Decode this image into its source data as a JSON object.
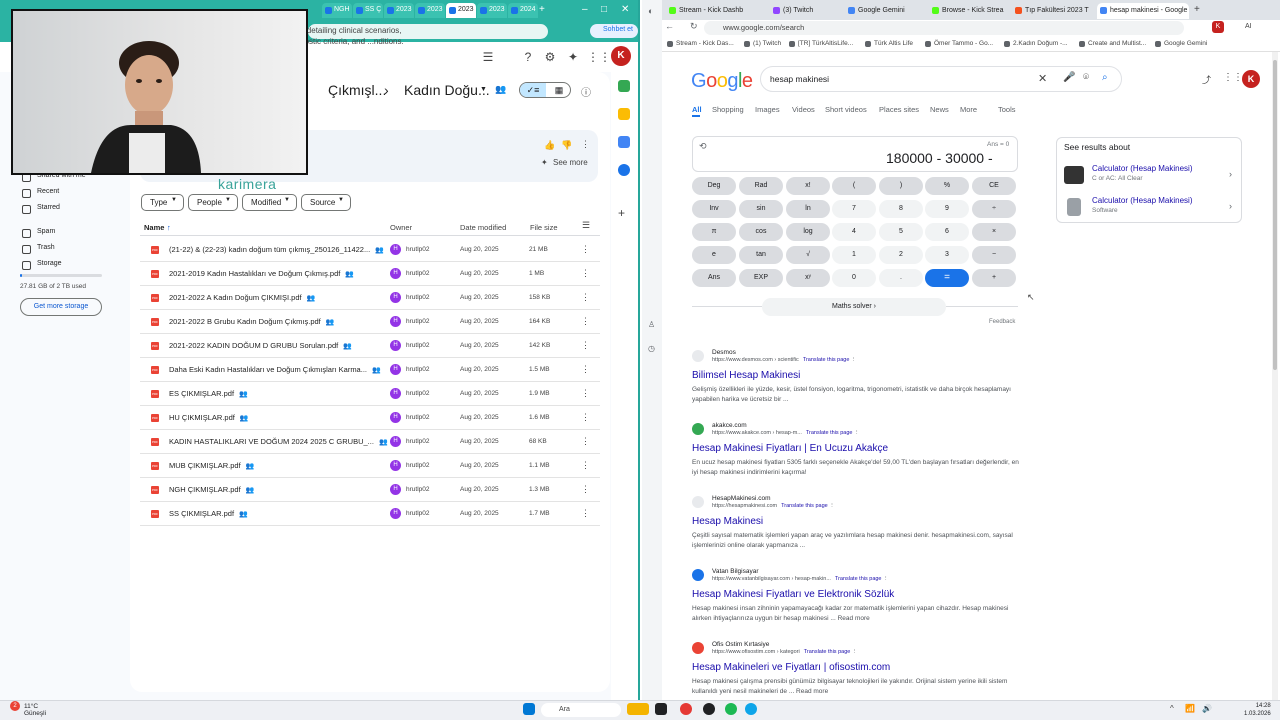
{
  "left_window": {
    "tabs": [
      "",
      "",
      "",
      "",
      "NGH",
      "SS Ç",
      "2023",
      "2023",
      "2023",
      "2023",
      "2023",
      "2024",
      "2024"
    ],
    "sohbet_label": "Sohbet et",
    "avatar_letter": "K",
    "breadcrumb": [
      "Çıkmışl...",
      "Kadın Doğu..."
    ],
    "summary_text": "...ons detailing clinical scenarios, diagnostic criteria, and ...nditions.",
    "see_more": "See more",
    "karimera": "karimera",
    "filters": [
      "Type",
      "People",
      "Modified",
      "Source"
    ],
    "columns": {
      "name": "Name",
      "owner": "Owner",
      "modified": "Date modified",
      "size": "File size"
    },
    "nav": [
      "Shared with me",
      "Recent",
      "Starred",
      "Spam",
      "Trash",
      "Storage"
    ],
    "storage": {
      "used_text": "27.81 GB of 2 TB used",
      "fraction": 0.014,
      "button": "Get more storage"
    },
    "files": [
      {
        "name": "(21-22) & (22-23) kadın doğum tüm çıkmış_250126_11422...",
        "shared": true,
        "owner": "hrutlp02",
        "date": "Aug 20, 2025",
        "size": "21 MB"
      },
      {
        "name": "2021-2019 Kadın Hastalıkları ve Doğum Çıkmış.pdf",
        "shared": true,
        "owner": "hrutlp02",
        "date": "Aug 20, 2025",
        "size": "1 MB"
      },
      {
        "name": "2021-2022 A Kadın Doğum ÇIKMIŞI.pdf",
        "shared": true,
        "owner": "hrutlp02",
        "date": "Aug 20, 2025",
        "size": "158 KB"
      },
      {
        "name": "2021-2022 B Grubu Kadın Doğum Çıkmış.pdf",
        "shared": true,
        "owner": "hrutlp02",
        "date": "Aug 20, 2025",
        "size": "164 KB"
      },
      {
        "name": "2021-2022 KADIN DOĞUM D GRUBU Soruları.pdf",
        "shared": true,
        "owner": "hrutlp02",
        "date": "Aug 20, 2025",
        "size": "142 KB"
      },
      {
        "name": "Daha Eski Kadın Hastalıkları ve Doğum Çıkmışları Karma...",
        "shared": true,
        "owner": "hrutlp02",
        "date": "Aug 20, 2025",
        "size": "1.5 MB"
      },
      {
        "name": "ES ÇIKMIŞLAR.pdf",
        "shared": true,
        "owner": "hrutlp02",
        "date": "Aug 20, 2025",
        "size": "1.9 MB"
      },
      {
        "name": "HU ÇIKMIŞLAR.pdf",
        "shared": true,
        "owner": "hrutlp02",
        "date": "Aug 20, 2025",
        "size": "1.6 MB"
      },
      {
        "name": "KADIN HASTALIKLARI VE DOĞUM 2024 2025  C GRUBU_...",
        "shared": true,
        "owner": "hrutlp02",
        "date": "Aug 20, 2025",
        "size": "68 KB"
      },
      {
        "name": "MUB ÇIKMIŞLAR.pdf",
        "shared": true,
        "owner": "hrutlp02",
        "date": "Aug 20, 2025",
        "size": "1.1 MB"
      },
      {
        "name": "NGH ÇIKMIŞLAR.pdf",
        "shared": true,
        "owner": "hrutlp02",
        "date": "Aug 20, 2025",
        "size": "1.3 MB"
      },
      {
        "name": "SS ÇIKMIŞLAR.pdf",
        "shared": true,
        "owner": "hrutlp02",
        "date": "Aug 20, 2025",
        "size": "1.7 MB"
      }
    ],
    "owner_initial": "H"
  },
  "right_window": {
    "tabs": [
      {
        "label": "Stream - Kick Dashb",
        "color": "#53fc18"
      },
      {
        "label": "(3) Twitch",
        "color": "#9146ff"
      },
      {
        "label": "Google Gemini",
        "color": "#4285f4"
      },
      {
        "label": "Browse - Kick Strea",
        "color": "#53fc18"
      },
      {
        "label": "Tıp Fakültesi 2023 T",
        "color": "#f4511e"
      },
      {
        "label": "hesap makinesi - Google",
        "color": "#4285f4"
      }
    ],
    "url": "www.google.com/search",
    "bookmarks": [
      "Stream - Kick Das...",
      "(1) Twitch",
      "[TR] TürkAltisLife...",
      "Türk Altis Life",
      "Ömer Tammo - Go...",
      "2.Kadın Doğum -...",
      "Create and Multist...",
      "Google Gemini"
    ],
    "logo": "Google",
    "query": "hesap makinesi",
    "search_tabs": [
      "All",
      "Shopping",
      "Images",
      "Videos",
      "Short videos",
      "Places sites",
      "News",
      "More",
      "Tools"
    ],
    "avatar_letter": "K",
    "calculator": {
      "ans": "Ans = 0",
      "expression": "180000 - 30000 -",
      "keys": [
        [
          "Deg",
          "Rad",
          "x!",
          "(",
          ")",
          "%",
          "CE"
        ],
        [
          "Inv",
          "sin",
          "ln",
          "7",
          "8",
          "9",
          "÷"
        ],
        [
          "π",
          "cos",
          "log",
          "4",
          "5",
          "6",
          "×"
        ],
        [
          "e",
          "tan",
          "√",
          "1",
          "2",
          "3",
          "−"
        ],
        [
          "Ans",
          "EXP",
          "xʸ",
          "0",
          ".",
          "=",
          "+"
        ]
      ],
      "maths_solver": "Maths solver",
      "feedback": "Feedback"
    },
    "knowledge_panel": {
      "title": "See results about",
      "items": [
        {
          "title": "Calculator (Hesap Makinesi)",
          "subtitle": "C or AC: All Clear"
        },
        {
          "title": "Calculator (Hesap Makinesi)",
          "subtitle": "Software"
        }
      ]
    },
    "translate_label": "Translate this page",
    "results": [
      {
        "site": "Desmos",
        "path": "https://www.desmos.com › scientific",
        "title": "Bilimsel Hesap Makinesi",
        "snippet": "Gelişmiş özellikleri ile yüzde, kesir, üstel fonsiyon, logaritma, trigonometri, istatistik ve daha birçok hesaplamayı yapabilen harika ve ücretsiz bir ..."
      },
      {
        "site": "akakce.com",
        "path": "https://www.akakce.com › hesap-m...",
        "title": "Hesap Makinesi Fiyatları | En Ucuzu Akakçe",
        "snippet": "En ucuz hesap makinesi fiyatları 5305 farklı seçenekle Akakçe'de! 59,00 TL'den başlayan fırsatları değerlendir, en iyi hesap makinesi indirimlerini kaçırma!"
      },
      {
        "site": "HesapMakinesi.com",
        "path": "https://hesapmakinesi.com",
        "title": "Hesap Makinesi",
        "snippet": "Çeşitli sayısal matematik işlemleri yapan araç ve yazılımlara hesap makinesi denir. hesapmakinesi.com, sayısal işlemlerinizi online olarak yapmanıza ..."
      },
      {
        "site": "Vatan Bilgisayar",
        "path": "https://www.vatanbilgisayar.com › hesap-makin...",
        "title": "Hesap Makinesi Fiyatları ve Elektronik Sözlük",
        "snippet": "Hesap makinesi insan zihninin yapamayacağı kadar zor matematik işlemlerini yapan cihazdır. Hesap makinesi alırken ihtiyaçlarınıza uygun bir hesap makinesi ... Read more"
      },
      {
        "site": "Ofis Ostim Kırtasiye",
        "path": "https://www.ofisostim.com › kategori",
        "title": "Hesap Makineleri ve Fiyatları | ofisostim.com",
        "snippet": "Hesap makinesi çalışma prensibi günümüz bilgisayar teknolojileri ile yakındır. Orijinal sistem yerine ikili sistem kullanıldı yeni nesil makineleri de ... Read more"
      }
    ]
  },
  "taskbar": {
    "weather_temp": "11°C",
    "weather_desc": "Güneşli",
    "search_placeholder": "Ara",
    "time": "14:28",
    "date": "1.03.2026",
    "notification_count": "2"
  }
}
